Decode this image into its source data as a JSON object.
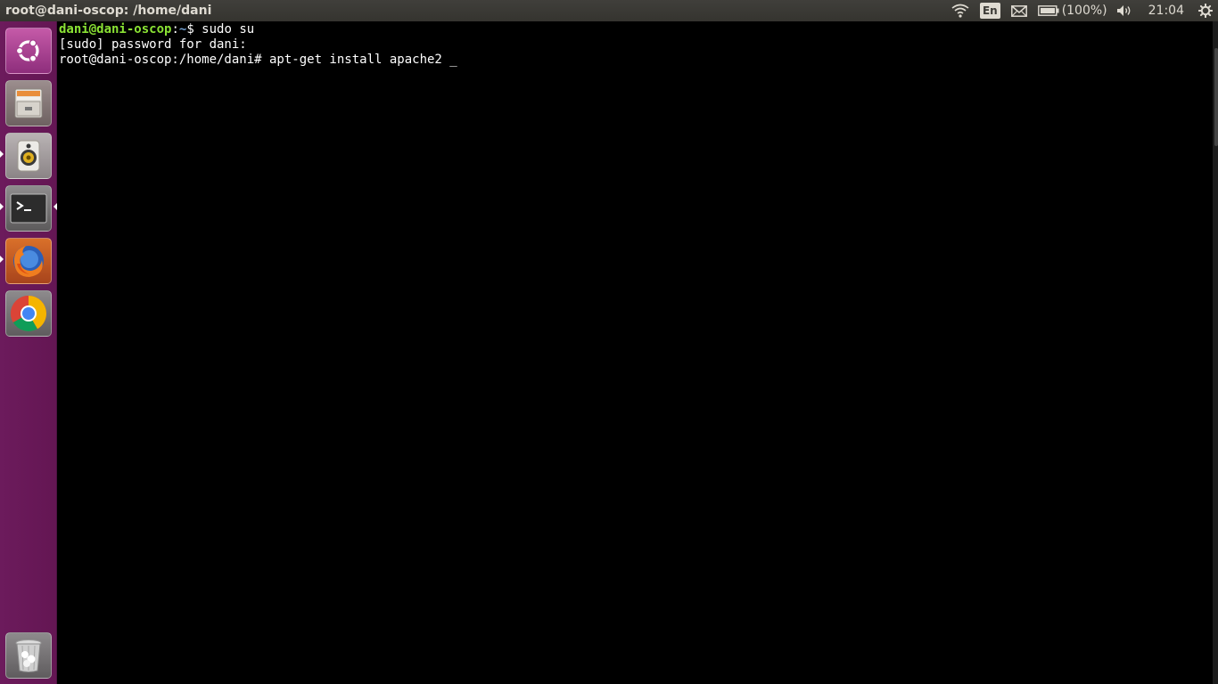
{
  "panel": {
    "window_title": "root@dani-oscop: /home/dani",
    "keyboard_layout": "En",
    "battery": "(100%)",
    "clock": "21:04"
  },
  "launcher": {
    "items": [
      {
        "name": "Dash",
        "icon": "ubuntu-logo-icon"
      },
      {
        "name": "Files",
        "icon": "file-cabinet-icon"
      },
      {
        "name": "Rhythmbox",
        "icon": "speaker-icon"
      },
      {
        "name": "Terminal",
        "icon": "terminal-icon"
      },
      {
        "name": "Firefox",
        "icon": "firefox-icon"
      },
      {
        "name": "Chrome",
        "icon": "chrome-icon"
      },
      {
        "name": "Trash",
        "icon": "trash-icon"
      }
    ]
  },
  "terminal": {
    "line1_user": "dani@dani-oscop",
    "line1_sep": ":",
    "line1_path": "~",
    "line1_cmd": "$ sudo su",
    "line2": "[sudo] password for dani:",
    "line3": "root@dani-oscop:/home/dani# apt-get install apache2 _"
  },
  "colors": {
    "panel_bg": "#3c3b37",
    "launcher_bg": "#6a1a5a",
    "prompt_user": "#8ae234",
    "prompt_path": "#729fcf",
    "terminal_bg": "#000000"
  }
}
